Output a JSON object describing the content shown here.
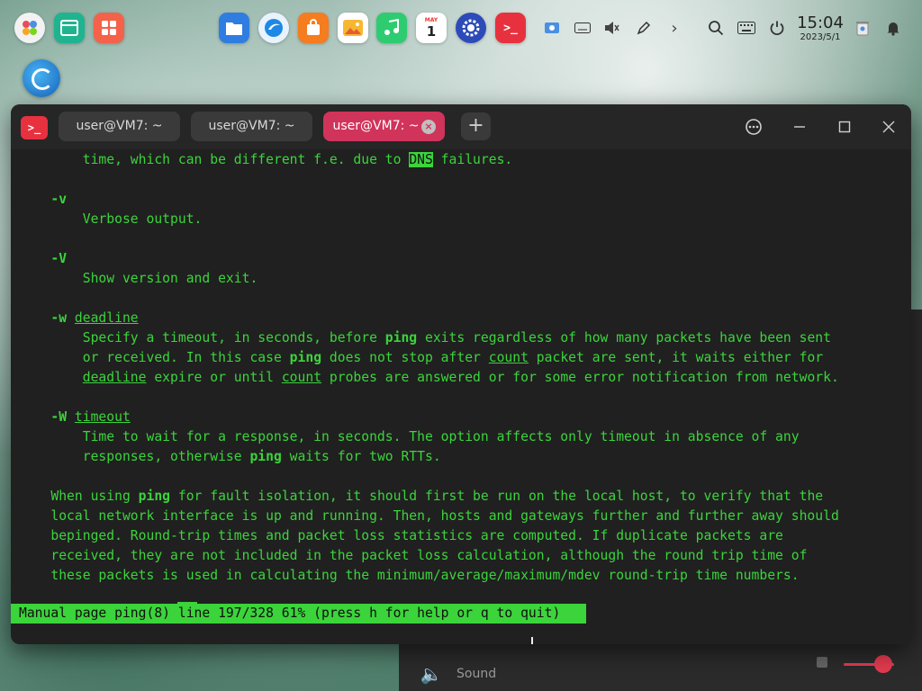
{
  "dock": {
    "clock_time": "15:04",
    "clock_date": "2023/5/1",
    "calendar_day": "1"
  },
  "terminal": {
    "tabs": [
      {
        "label": "user@VM7: ~"
      },
      {
        "label": "user@VM7: ~"
      },
      {
        "label": "user@VM7: ~"
      }
    ],
    "close_glyph": "×",
    "add_glyph": "+",
    "status_line": "Manual page ping(8) line 197/328 61% (press h for help or q to quit)",
    "lines": [
      {
        "indent": "        ",
        "parts": [
          {
            "t": "time, which can be different f.e. due to "
          },
          {
            "t": "DNS",
            "s": "hl"
          },
          {
            "t": " failures."
          }
        ]
      },
      {
        "indent": "",
        "parts": []
      },
      {
        "indent": "    ",
        "parts": [
          {
            "t": "-v",
            "s": "b"
          }
        ]
      },
      {
        "indent": "        ",
        "parts": [
          {
            "t": "Verbose output."
          }
        ]
      },
      {
        "indent": "",
        "parts": []
      },
      {
        "indent": "    ",
        "parts": [
          {
            "t": "-V",
            "s": "b"
          }
        ]
      },
      {
        "indent": "        ",
        "parts": [
          {
            "t": "Show version and exit."
          }
        ]
      },
      {
        "indent": "",
        "parts": []
      },
      {
        "indent": "    ",
        "parts": [
          {
            "t": "-w",
            "s": "b"
          },
          {
            "t": " "
          },
          {
            "t": "deadline",
            "s": "u"
          }
        ]
      },
      {
        "indent": "        ",
        "parts": [
          {
            "t": "Specify a timeout, in seconds, before "
          },
          {
            "t": "ping",
            "s": "b"
          },
          {
            "t": " exits regardless of how many packets have been sent"
          }
        ]
      },
      {
        "indent": "        ",
        "parts": [
          {
            "t": "or received. In this case "
          },
          {
            "t": "ping",
            "s": "b"
          },
          {
            "t": " does not stop after "
          },
          {
            "t": "count",
            "s": "u"
          },
          {
            "t": " packet are sent, it waits either for"
          }
        ]
      },
      {
        "indent": "        ",
        "parts": [
          {
            "t": "deadline",
            "s": "u"
          },
          {
            "t": " expire or until "
          },
          {
            "t": "count",
            "s": "u"
          },
          {
            "t": " probes are answered or for some error notification from network."
          }
        ]
      },
      {
        "indent": "",
        "parts": []
      },
      {
        "indent": "    ",
        "parts": [
          {
            "t": "-W",
            "s": "b"
          },
          {
            "t": " "
          },
          {
            "t": "timeout",
            "s": "u"
          }
        ]
      },
      {
        "indent": "        ",
        "parts": [
          {
            "t": "Time to wait for a response, in seconds. The option affects only timeout in absence of any"
          }
        ]
      },
      {
        "indent": "        ",
        "parts": [
          {
            "t": "responses, otherwise "
          },
          {
            "t": "ping",
            "s": "b"
          },
          {
            "t": " waits for two RTTs."
          }
        ]
      },
      {
        "indent": "",
        "parts": []
      },
      {
        "indent": "    ",
        "parts": [
          {
            "t": "When using "
          },
          {
            "t": "ping",
            "s": "b"
          },
          {
            "t": " for fault isolation, it should first be run on the local host, to verify that the"
          }
        ]
      },
      {
        "indent": "    ",
        "parts": [
          {
            "t": "local network interface is up and running. Then, hosts and gateways further and further away should"
          }
        ]
      },
      {
        "indent": "    ",
        "parts": [
          {
            "t": "bepinged. Round-trip times and packet loss statistics are computed. If duplicate packets are"
          }
        ]
      },
      {
        "indent": "    ",
        "parts": [
          {
            "t": "received, they are not included in the packet loss calculation, although the round trip time of"
          }
        ]
      },
      {
        "indent": "    ",
        "parts": [
          {
            "t": "these packets is used in calculating the minimum/average/maximum/mdev round-trip time numbers."
          }
        ]
      }
    ]
  },
  "background_panel": {
    "sound_label": "Sound"
  },
  "colors": {
    "terminal_text": "#3bd43b",
    "active_tab": "#d0345b",
    "terminal_bg": "#202020"
  }
}
